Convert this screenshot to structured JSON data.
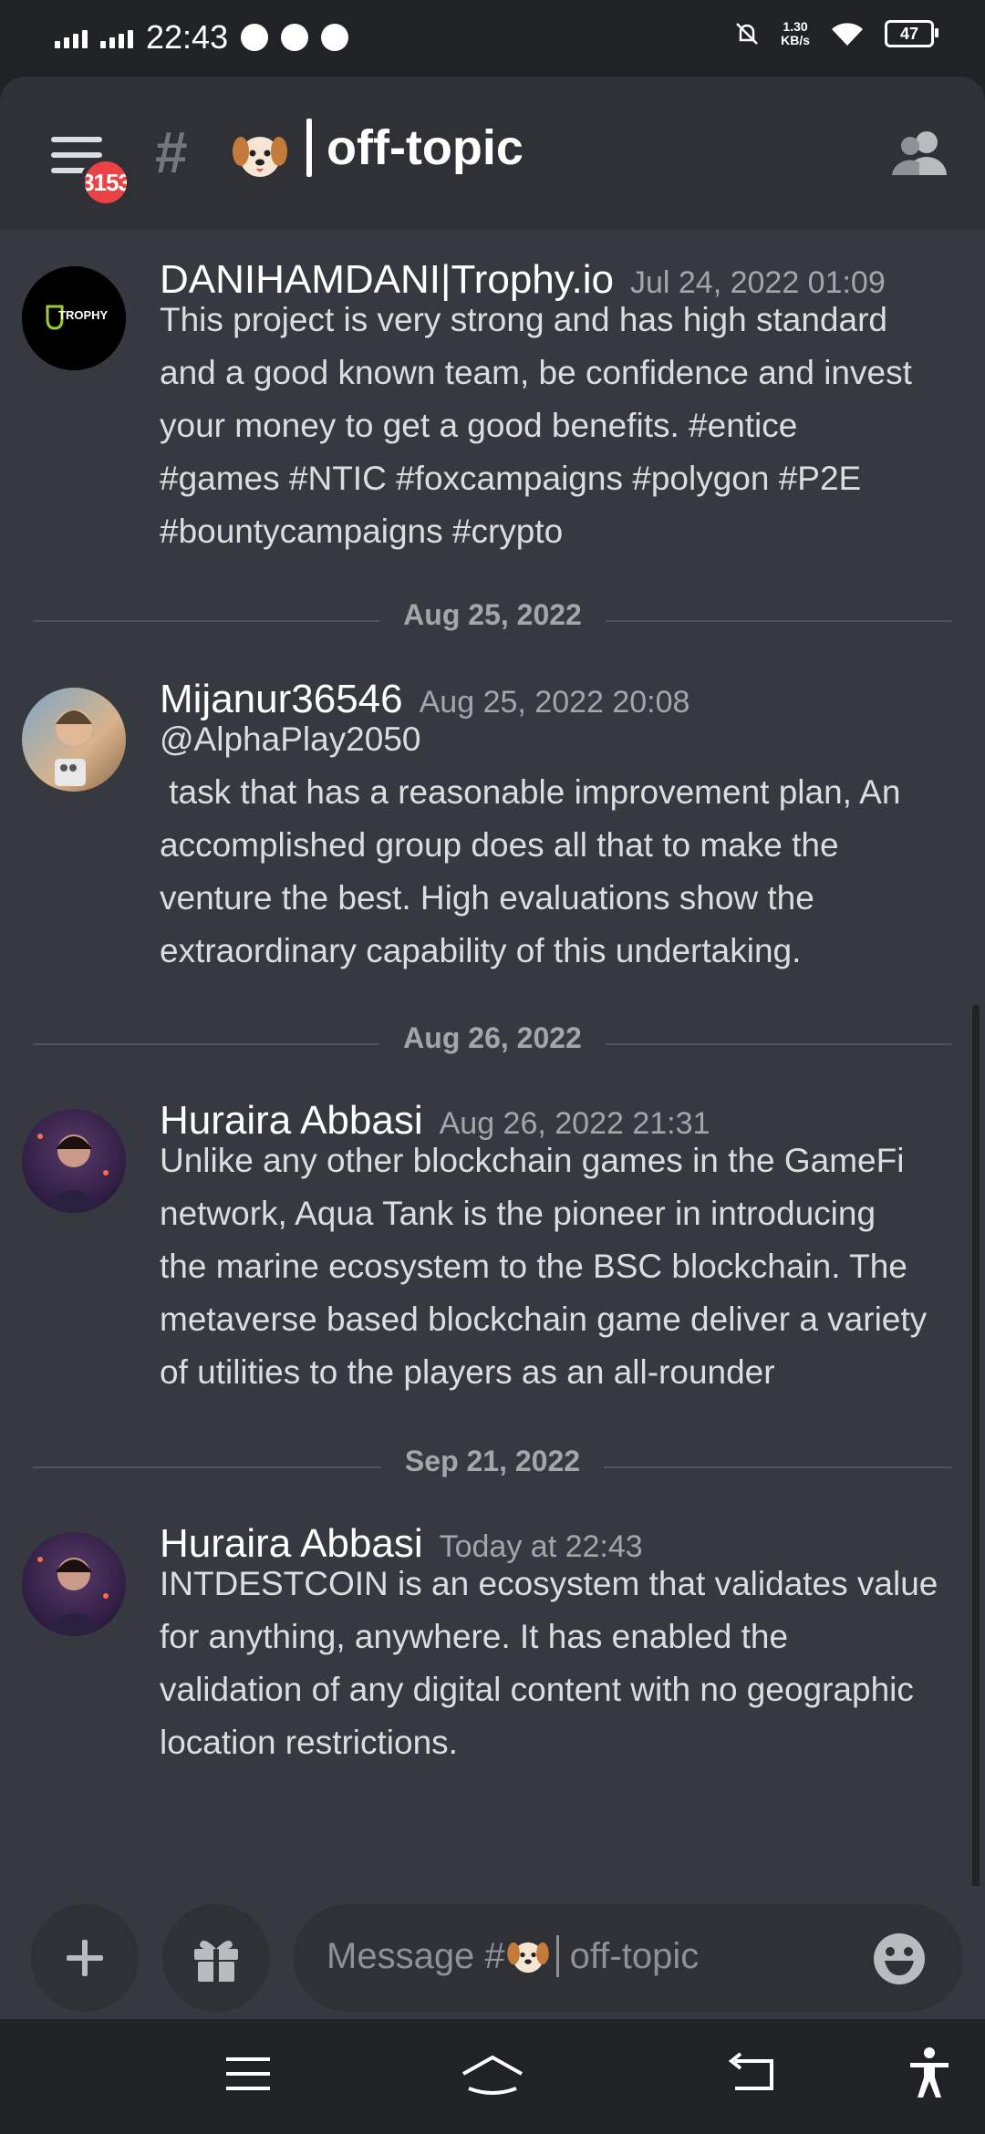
{
  "status_bar": {
    "time": "22:43",
    "net_speed": "1.30",
    "net_unit": "KB/s",
    "battery": "47"
  },
  "header": {
    "hash": "#",
    "channel_name": "off-topic",
    "unread_badge": "3153"
  },
  "messages": [
    {
      "author": "DANIHAMDANI|Trophy.io",
      "timestamp": "Jul 24, 2022 01:09",
      "avatar_text": "TROPHY",
      "lines": [
        "This project is very strong and has high standard",
        "and a good known team, be confidence and invest",
        "your money to get a good benefits. #entice",
        "#games #NTIC #foxcampaigns #polygon #P2E",
        "#bountycampaigns #crypto"
      ]
    },
    {
      "author": "Mijanur36546",
      "timestamp": "Aug 25, 2022 20:08",
      "lines": [
        "@AlphaPlay2050",
        " task that has a reasonable improvement plan, An",
        "accomplished group does all that to make the",
        "venture the best. High evaluations show the",
        "extraordinary capability of this undertaking."
      ]
    },
    {
      "author": "Huraira Abbasi",
      "timestamp": "Aug 26, 2022 21:31",
      "lines": [
        "Unlike any other blockchain games in the GameFi",
        "network, Aqua Tank is the pioneer in introducing",
        "the marine ecosystem to the BSC blockchain. The",
        "metaverse based blockchain game deliver a variety",
        "of utilities to the players as an all-rounder"
      ]
    },
    {
      "author": "Huraira Abbasi",
      "timestamp": "Today at 22:43",
      "lines": [
        "INTDESTCOIN is an ecosystem that validates value",
        "for anything, anywhere. It has enabled the",
        "validation of any digital content with no geographic",
        "location restrictions."
      ]
    }
  ],
  "date_dividers": [
    "Aug 25, 2022",
    "Aug 26, 2022",
    "Sep 21, 2022"
  ],
  "composer": {
    "placeholder_prefix": "Message #",
    "placeholder_channel": "off-topic"
  },
  "colors": {
    "background": "#36393f",
    "header": "#2f3136",
    "badge": "#ed4245",
    "text": "#dcddde",
    "muted": "#a3a6aa"
  },
  "icons": [
    "hamburger-icon",
    "hash-icon",
    "dog-emoji-icon",
    "members-icon",
    "plus-icon",
    "gift-icon",
    "emoji-icon",
    "nav-menu-icon",
    "nav-home-icon",
    "nav-back-icon",
    "accessibility-icon"
  ]
}
